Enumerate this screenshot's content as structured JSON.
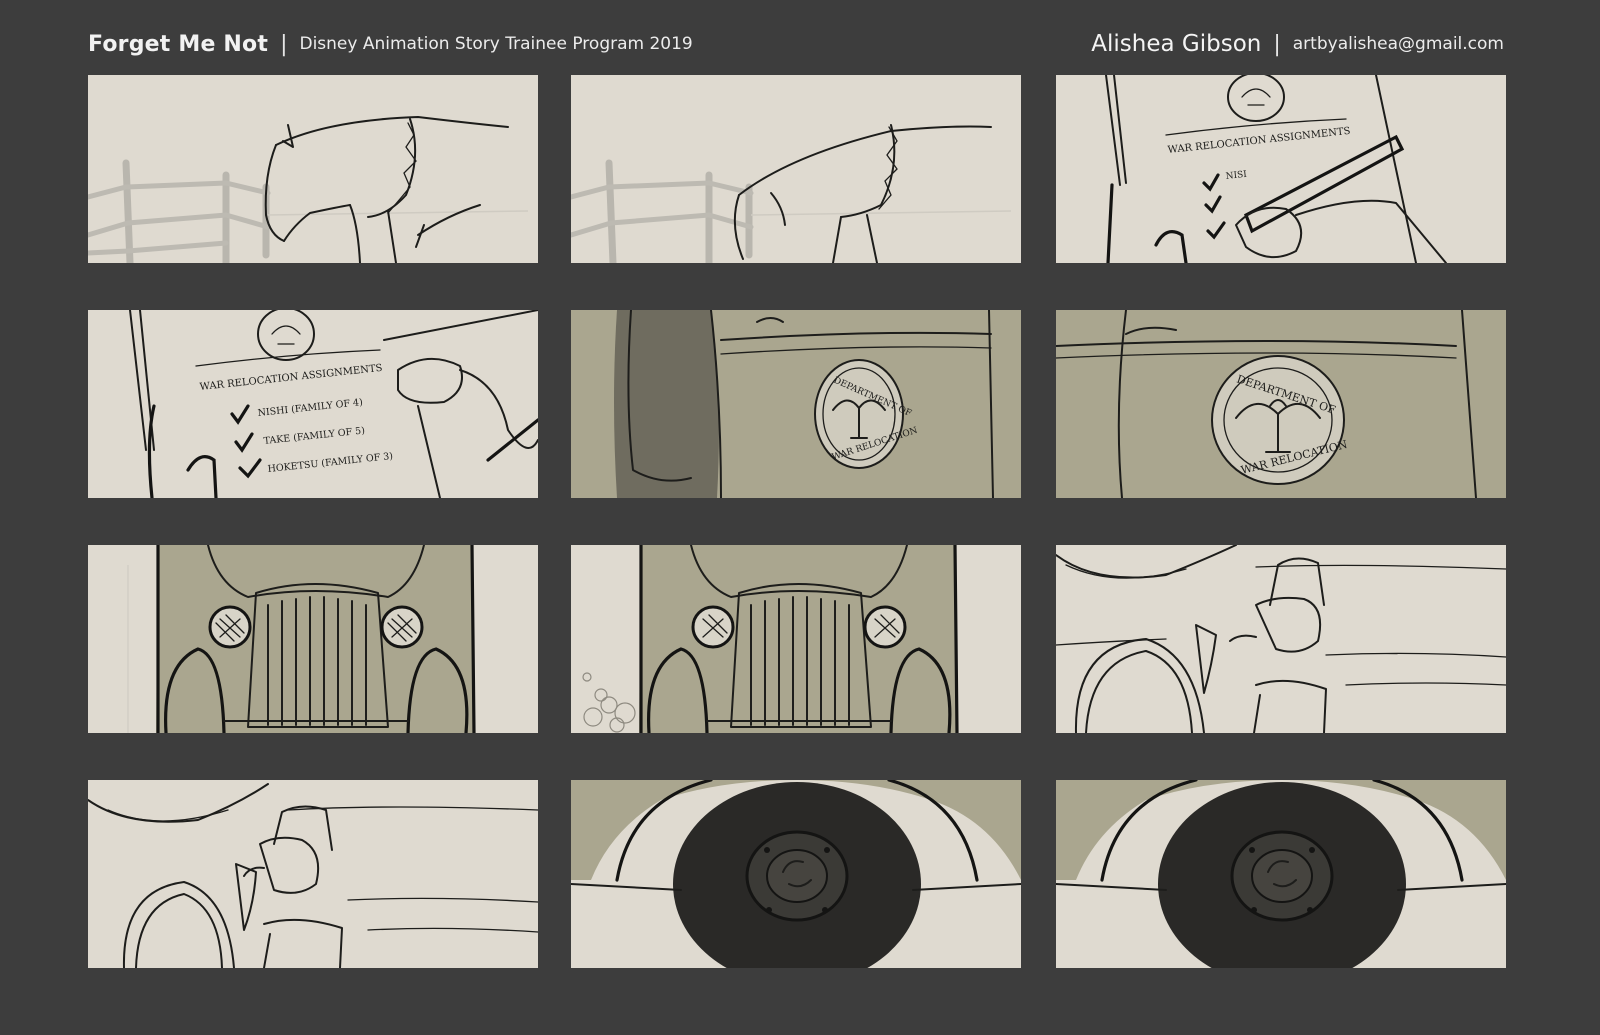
{
  "header": {
    "title": "Forget Me Not",
    "separator": "|",
    "subtitle": "Disney Animation Story Trainee Program 2019",
    "author": "Alishea Gibson",
    "email": "artbyalishea@gmail.com"
  },
  "panel_text": {
    "form_title": "WAR RELOCATION ASSIGNMENTS",
    "entries": [
      "NISHI (FAMILY OF 4)",
      "TAKE (FAMILY OF 5)",
      "HOKETSU (FAMILY OF 3)"
    ],
    "emblem_top": "DEPARTMENT OF",
    "emblem_bottom": "WAR RELOCATION",
    "partial_entry": "NISI"
  },
  "colors": {
    "page_background": "#3d3d3d",
    "panel_paper": "#dfdad0",
    "truck_olive": "#aaa68f",
    "ink": "#1d1d1b"
  },
  "icons": {
    "eagle_seal": "eagle-emblem-icon",
    "checkmark": "checkmark-icon"
  }
}
